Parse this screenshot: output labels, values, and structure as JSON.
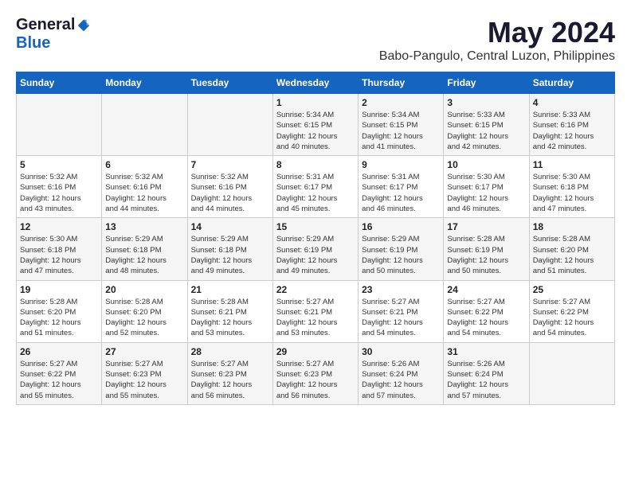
{
  "logo": {
    "general": "General",
    "blue": "Blue"
  },
  "title": {
    "month": "May 2024",
    "location": "Babo-Pangulo, Central Luzon, Philippines"
  },
  "headers": [
    "Sunday",
    "Monday",
    "Tuesday",
    "Wednesday",
    "Thursday",
    "Friday",
    "Saturday"
  ],
  "weeks": [
    [
      {
        "day": "",
        "info": ""
      },
      {
        "day": "",
        "info": ""
      },
      {
        "day": "",
        "info": ""
      },
      {
        "day": "1",
        "info": "Sunrise: 5:34 AM\nSunset: 6:15 PM\nDaylight: 12 hours\nand 40 minutes."
      },
      {
        "day": "2",
        "info": "Sunrise: 5:34 AM\nSunset: 6:15 PM\nDaylight: 12 hours\nand 41 minutes."
      },
      {
        "day": "3",
        "info": "Sunrise: 5:33 AM\nSunset: 6:15 PM\nDaylight: 12 hours\nand 42 minutes."
      },
      {
        "day": "4",
        "info": "Sunrise: 5:33 AM\nSunset: 6:16 PM\nDaylight: 12 hours\nand 42 minutes."
      }
    ],
    [
      {
        "day": "5",
        "info": "Sunrise: 5:32 AM\nSunset: 6:16 PM\nDaylight: 12 hours\nand 43 minutes."
      },
      {
        "day": "6",
        "info": "Sunrise: 5:32 AM\nSunset: 6:16 PM\nDaylight: 12 hours\nand 44 minutes."
      },
      {
        "day": "7",
        "info": "Sunrise: 5:32 AM\nSunset: 6:16 PM\nDaylight: 12 hours\nand 44 minutes."
      },
      {
        "day": "8",
        "info": "Sunrise: 5:31 AM\nSunset: 6:17 PM\nDaylight: 12 hours\nand 45 minutes."
      },
      {
        "day": "9",
        "info": "Sunrise: 5:31 AM\nSunset: 6:17 PM\nDaylight: 12 hours\nand 46 minutes."
      },
      {
        "day": "10",
        "info": "Sunrise: 5:30 AM\nSunset: 6:17 PM\nDaylight: 12 hours\nand 46 minutes."
      },
      {
        "day": "11",
        "info": "Sunrise: 5:30 AM\nSunset: 6:18 PM\nDaylight: 12 hours\nand 47 minutes."
      }
    ],
    [
      {
        "day": "12",
        "info": "Sunrise: 5:30 AM\nSunset: 6:18 PM\nDaylight: 12 hours\nand 47 minutes."
      },
      {
        "day": "13",
        "info": "Sunrise: 5:29 AM\nSunset: 6:18 PM\nDaylight: 12 hours\nand 48 minutes."
      },
      {
        "day": "14",
        "info": "Sunrise: 5:29 AM\nSunset: 6:18 PM\nDaylight: 12 hours\nand 49 minutes."
      },
      {
        "day": "15",
        "info": "Sunrise: 5:29 AM\nSunset: 6:19 PM\nDaylight: 12 hours\nand 49 minutes."
      },
      {
        "day": "16",
        "info": "Sunrise: 5:29 AM\nSunset: 6:19 PM\nDaylight: 12 hours\nand 50 minutes."
      },
      {
        "day": "17",
        "info": "Sunrise: 5:28 AM\nSunset: 6:19 PM\nDaylight: 12 hours\nand 50 minutes."
      },
      {
        "day": "18",
        "info": "Sunrise: 5:28 AM\nSunset: 6:20 PM\nDaylight: 12 hours\nand 51 minutes."
      }
    ],
    [
      {
        "day": "19",
        "info": "Sunrise: 5:28 AM\nSunset: 6:20 PM\nDaylight: 12 hours\nand 51 minutes."
      },
      {
        "day": "20",
        "info": "Sunrise: 5:28 AM\nSunset: 6:20 PM\nDaylight: 12 hours\nand 52 minutes."
      },
      {
        "day": "21",
        "info": "Sunrise: 5:28 AM\nSunset: 6:21 PM\nDaylight: 12 hours\nand 53 minutes."
      },
      {
        "day": "22",
        "info": "Sunrise: 5:27 AM\nSunset: 6:21 PM\nDaylight: 12 hours\nand 53 minutes."
      },
      {
        "day": "23",
        "info": "Sunrise: 5:27 AM\nSunset: 6:21 PM\nDaylight: 12 hours\nand 54 minutes."
      },
      {
        "day": "24",
        "info": "Sunrise: 5:27 AM\nSunset: 6:22 PM\nDaylight: 12 hours\nand 54 minutes."
      },
      {
        "day": "25",
        "info": "Sunrise: 5:27 AM\nSunset: 6:22 PM\nDaylight: 12 hours\nand 54 minutes."
      }
    ],
    [
      {
        "day": "26",
        "info": "Sunrise: 5:27 AM\nSunset: 6:22 PM\nDaylight: 12 hours\nand 55 minutes."
      },
      {
        "day": "27",
        "info": "Sunrise: 5:27 AM\nSunset: 6:23 PM\nDaylight: 12 hours\nand 55 minutes."
      },
      {
        "day": "28",
        "info": "Sunrise: 5:27 AM\nSunset: 6:23 PM\nDaylight: 12 hours\nand 56 minutes."
      },
      {
        "day": "29",
        "info": "Sunrise: 5:27 AM\nSunset: 6:23 PM\nDaylight: 12 hours\nand 56 minutes."
      },
      {
        "day": "30",
        "info": "Sunrise: 5:26 AM\nSunset: 6:24 PM\nDaylight: 12 hours\nand 57 minutes."
      },
      {
        "day": "31",
        "info": "Sunrise: 5:26 AM\nSunset: 6:24 PM\nDaylight: 12 hours\nand 57 minutes."
      },
      {
        "day": "",
        "info": ""
      }
    ]
  ]
}
